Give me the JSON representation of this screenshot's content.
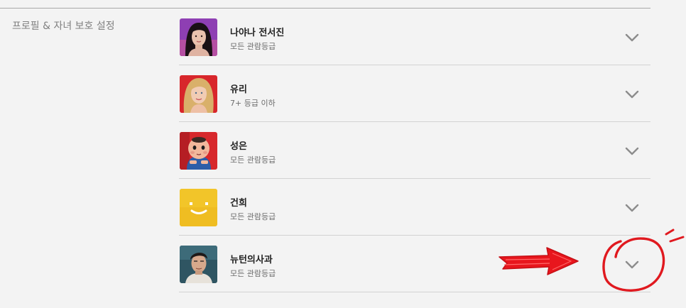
{
  "section": {
    "title": "프로필 & 자녀 보호 설정"
  },
  "profiles": [
    {
      "name": "나야나 전서진",
      "rating": "모든 관람등급",
      "avatar": "photo-woman-dark-hair"
    },
    {
      "name": "유리",
      "rating": "7+ 등급 이하",
      "avatar": "photo-woman-blonde"
    },
    {
      "name": "성은",
      "rating": "모든 관람등급",
      "avatar": "cartoon-baby-red-background"
    },
    {
      "name": "건희",
      "rating": "모든 관람등급",
      "avatar": "yellow-smiley-face"
    },
    {
      "name": "뉴턴의사과",
      "rating": "모든 관람등급",
      "avatar": "photo-man-dark-hair"
    }
  ],
  "icons": {
    "expand": "chevron-down-icon",
    "annotation_arrow": "red-arrow-annotation",
    "annotation_circle": "red-circle-annotation"
  },
  "colors": {
    "background": "#f3f3f3",
    "annotation": "#e0191f",
    "chevron": "#8c8c8c"
  }
}
